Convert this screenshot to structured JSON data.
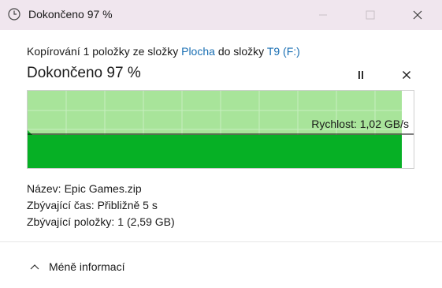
{
  "window": {
    "title": "Dokončeno 97 %",
    "icon": "clock-icon"
  },
  "copy": {
    "prefix": "Kopírování 1 položky ze složky",
    "source": "Plocha",
    "middle": "do složky",
    "destination": "T9 (F:)"
  },
  "status": {
    "title": "Dokončeno 97 %",
    "progress": 0.97
  },
  "graph": {
    "speed_label": "Rychlost: 1,02 GB/s",
    "colors": {
      "progress": "#a8e49a",
      "throughput": "#06b025",
      "grid": "#c7eec0",
      "line": "#000000"
    }
  },
  "details": {
    "name_label": "Název:",
    "name_value": "Epic Games.zip",
    "time_label": "Zbývající čas:",
    "time_value": "Přibližně 5 s",
    "items_label": "Zbývající položky:",
    "items_value": "1 (2,59 GB)"
  },
  "footer": {
    "toggle_label": "Méně informací"
  }
}
